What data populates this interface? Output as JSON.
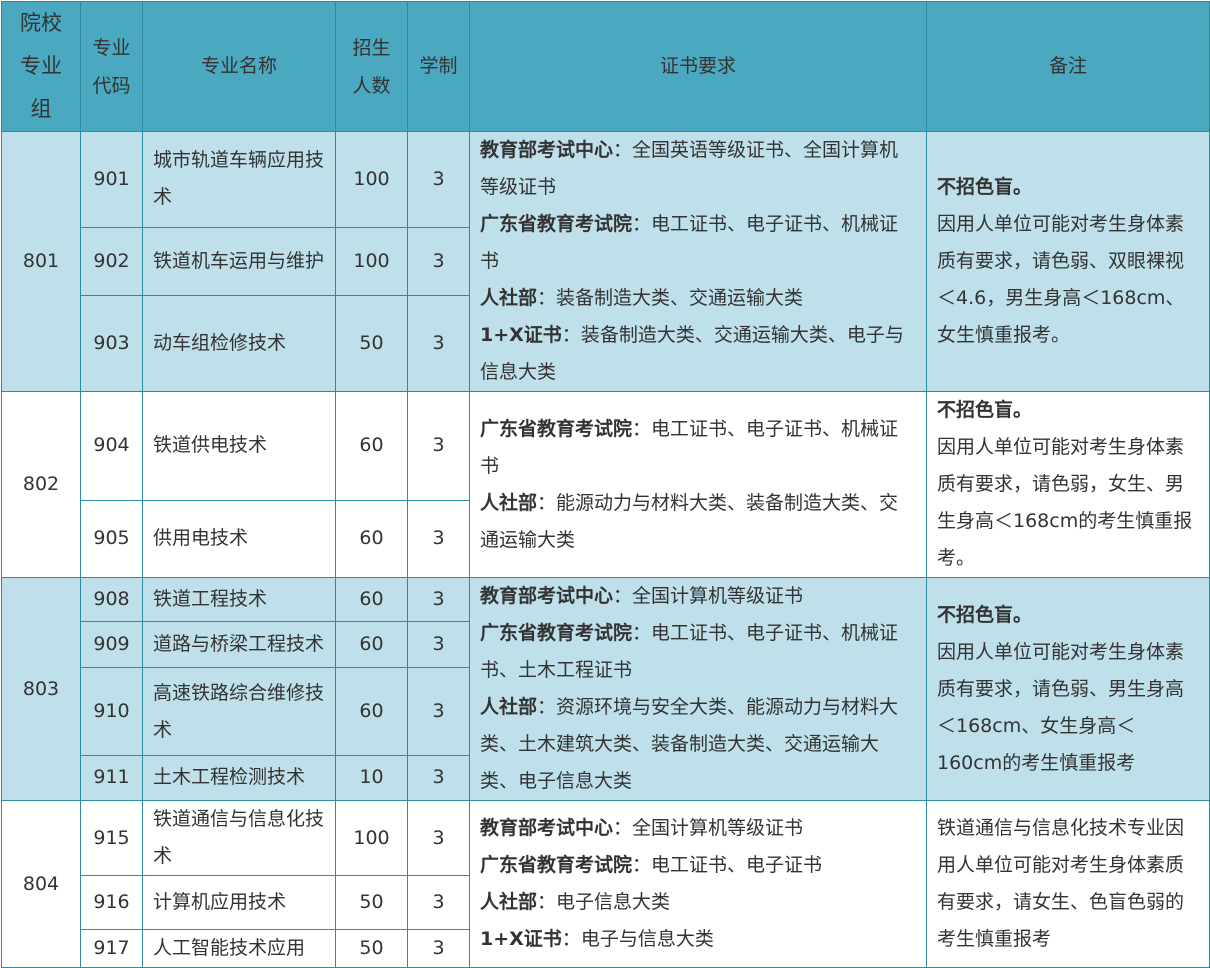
{
  "header": {
    "group": "院校专业组",
    "code": "专业代码",
    "name": "专业名称",
    "quota": "招生人数",
    "years": "学制",
    "cert": "证书要求",
    "note": "备注"
  },
  "groups": [
    {
      "group": "801",
      "rows": [
        {
          "code": "901",
          "name": "城市轨道车辆应用技术",
          "quota": "100",
          "years": "3"
        },
        {
          "code": "902",
          "name": "铁道机车运用与维护",
          "quota": "100",
          "years": "3"
        },
        {
          "code": "903",
          "name": "动车组检修技术",
          "quota": "50",
          "years": "3"
        }
      ],
      "cert": [
        {
          "org": "教育部考试中心",
          "sep": "：",
          "text": "全国英语等级证书、全国计算机等级证书"
        },
        {
          "org": "广东省教育考试院",
          "sep": "：",
          "text": "电工证书、电子证书、机械证书"
        },
        {
          "org": "人社部",
          "sep": "：",
          "text": "装备制造大类、交通运输大类"
        },
        {
          "org": "1+X证书",
          "sep": "：",
          "text": "装备制造大类、交通运输大类、电子与信息大类"
        }
      ],
      "note_strong": "不招色盲。",
      "note": "因用人单位可能对考生身体素质有要求，请色弱、双眼裸视＜4.6，男生身高＜168cm、女生慎重报考。"
    },
    {
      "group": "802",
      "rows": [
        {
          "code": "904",
          "name": "铁道供电技术",
          "quota": "60",
          "years": "3"
        },
        {
          "code": "905",
          "name": "供用电技术",
          "quota": "60",
          "years": "3"
        }
      ],
      "cert": [
        {
          "org": "广东省教育考试院",
          "sep": "：",
          "text": "电工证书、电子证书、机械证书"
        },
        {
          "org": "人社部",
          "sep": "：",
          "text": "能源动力与材料大类、装备制造大类、交通运输大类"
        }
      ],
      "note_strong": "不招色盲。",
      "note": "因用人单位可能对考生身体素质有要求，请色弱，女生、男生身高＜168cm的考生慎重报考。"
    },
    {
      "group": "803",
      "rows": [
        {
          "code": "908",
          "name": "铁道工程技术",
          "quota": "60",
          "years": "3"
        },
        {
          "code": "909",
          "name": "道路与桥梁工程技术",
          "quota": "60",
          "years": "3"
        },
        {
          "code": "910",
          "name": "高速铁路综合维修技术",
          "quota": "60",
          "years": "3"
        },
        {
          "code": "911",
          "name": "土木工程检测技术",
          "quota": "10",
          "years": "3"
        }
      ],
      "cert": [
        {
          "org": "教育部考试中心",
          "sep": "：",
          "text": "全国计算机等级证书"
        },
        {
          "org": "广东省教育考试院",
          "sep": "：",
          "text": "电工证书、电子证书、机械证书、土木工程证书"
        },
        {
          "org": "人社部",
          "sep": "：",
          "text": "资源环境与安全大类、能源动力与材料大类、土木建筑大类、装备制造大类、交通运输大类、电子信息大类"
        }
      ],
      "note_strong": "不招色盲。",
      "note": "因用人单位可能对考生身体素质有要求，请色弱、男生身高＜168cm、女生身高＜160cm的考生慎重报考"
    },
    {
      "group": "804",
      "rows": [
        {
          "code": "915",
          "name": "铁道通信与信息化技术",
          "quota": "100",
          "years": "3"
        },
        {
          "code": "916",
          "name": "计算机应用技术",
          "quota": "50",
          "years": "3"
        },
        {
          "code": "917",
          "name": "人工智能技术应用",
          "quota": "50",
          "years": "3"
        }
      ],
      "cert": [
        {
          "org": "教育部考试中心",
          "sep": "：",
          "text": "全国计算机等级证书"
        },
        {
          "org": "广东省教育考试院",
          "sep": "：",
          "text": "电工证书、电子证书"
        },
        {
          "org": "人社部",
          "sep": "：",
          "text": "电子信息大类"
        },
        {
          "org": "1+X证书",
          "sep": "：",
          "text": "电子与信息大类"
        }
      ],
      "note_strong": "",
      "note": "铁道通信与信息化技术专业因用人单位可能对考生身体素质有要求，请女生、色盲色弱的考生慎重报考"
    }
  ]
}
